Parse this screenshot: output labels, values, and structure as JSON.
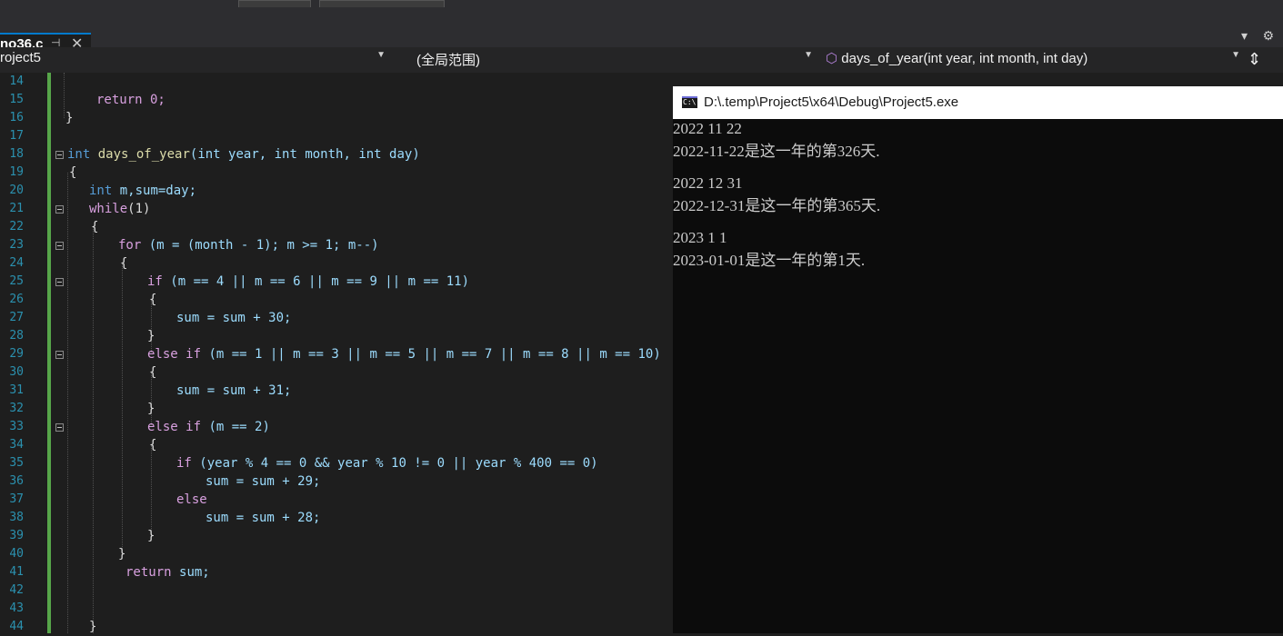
{
  "tab": {
    "title": "no36.c",
    "pin": "⊣",
    "close": "✕"
  },
  "navbar": {
    "project": "roject5",
    "scope": "(全局范围)",
    "function": "days_of_year(int year, int month, int day)"
  },
  "gutter": {
    "line_numbers": [
      "14",
      "15",
      "16",
      "17",
      "18",
      "19",
      "20",
      "21",
      "22",
      "23",
      "24",
      "25",
      "26",
      "27",
      "28",
      "29",
      "30",
      "31",
      "32",
      "33",
      "34",
      "35",
      "36",
      "37",
      "38",
      "39",
      "40",
      "41",
      "42",
      "43",
      "44"
    ]
  },
  "code": {
    "l15": "return 0;",
    "l16": "}",
    "l18_kw": "int",
    "l18_fn": "days_of_year",
    "l18_rest": "(int year, int month, int day)",
    "l19": "{",
    "l20_kw": "int",
    "l20_rest": "m,sum=day;",
    "l21_kw": "while",
    "l21_rest": "(1)",
    "l22": "{",
    "l23_kw": "for",
    "l23_rest": "(m = (month - 1); m >= 1; m--)",
    "l24": "{",
    "l25_kw": "if",
    "l25_rest": "(m == 4 || m == 6 || m == 9 || m == 11)",
    "l26": "{",
    "l27": "sum = sum + 30;",
    "l28": "}",
    "l29_kw": "else if",
    "l29_rest": "(m == 1 || m == 3 || m == 5 || m == 7 || m == 8 || m == 10)",
    "l30": "{",
    "l31": "sum = sum + 31;",
    "l32": "}",
    "l33_kw": "else if",
    "l33_rest": "(m == 2)",
    "l34": "{",
    "l35_kw": "if",
    "l35_rest": "(year % 4 == 0 && year % 10 != 0 || year % 400 == 0)",
    "l36": "sum = sum + 29;",
    "l37_kw": "else",
    "l38": "sum = sum + 28;",
    "l39": "}",
    "l40": "}",
    "l41_kw": "return",
    "l41_rest": "sum;",
    "l44": "}"
  },
  "console": {
    "title": "D:\\.temp\\Project5\\x64\\Debug\\Project5.exe",
    "icon": "C:\\",
    "lines": [
      "2022 11 22",
      "2022-11-22是这一年的第326天.",
      "",
      "2022 12 31",
      "2022-12-31是这一年的第365天.",
      "",
      "2023 1 1",
      "2023-01-01是这一年的第1天."
    ]
  },
  "colors": {
    "accent": "#007acc",
    "change_bar": "#57a64a",
    "keyword": "#569cd6",
    "control": "#d8a0df"
  }
}
